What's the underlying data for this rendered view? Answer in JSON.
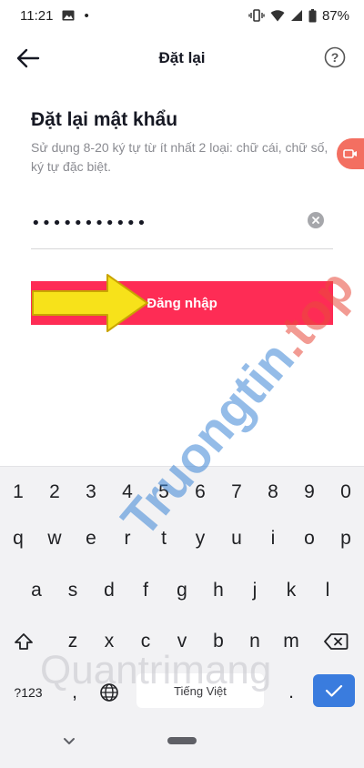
{
  "status_bar": {
    "time": "11:21",
    "dot": "•",
    "battery": "87%"
  },
  "header": {
    "title": "Đặt lại"
  },
  "form": {
    "heading": "Đặt lại mật khẩu",
    "hint": "Sử dụng 8-20 ký tự từ ít nhất 2 loại: chữ cái, chữ số, ký tự đặc biệt.",
    "password_value": "•••••••••••",
    "submit_label": "Đăng nhập"
  },
  "keyboard": {
    "row_numbers": [
      "1",
      "2",
      "3",
      "4",
      "5",
      "6",
      "7",
      "8",
      "9",
      "0"
    ],
    "row_top": [
      "q",
      "w",
      "e",
      "r",
      "t",
      "y",
      "u",
      "i",
      "o",
      "p"
    ],
    "row_middle": [
      "a",
      "s",
      "d",
      "f",
      "g",
      "h",
      "j",
      "k",
      "l"
    ],
    "row_bottom": [
      "z",
      "x",
      "c",
      "v",
      "b",
      "n",
      "m"
    ],
    "symbols_label": "?123",
    "space_label": "Tiếng Việt",
    "comma": ",",
    "period": "."
  },
  "watermark": {
    "brand_part1": "Truongtin",
    "brand_dot": ".",
    "brand_part2": "top",
    "sub": "Quantrimang"
  },
  "colors": {
    "accent": "#fe2c55",
    "keyboard_enter": "#3a7cde",
    "arrow_fill": "#f7e21a",
    "arrow_stroke": "#c9a400"
  },
  "icons": {
    "back": "arrow-left-icon",
    "help": "question-circle-icon",
    "clear": "clear-x-icon",
    "shift": "shift-icon",
    "backspace": "backspace-icon",
    "globe": "globe-icon",
    "enter": "checkmark-icon",
    "nav_back": "chevron-down-icon"
  }
}
